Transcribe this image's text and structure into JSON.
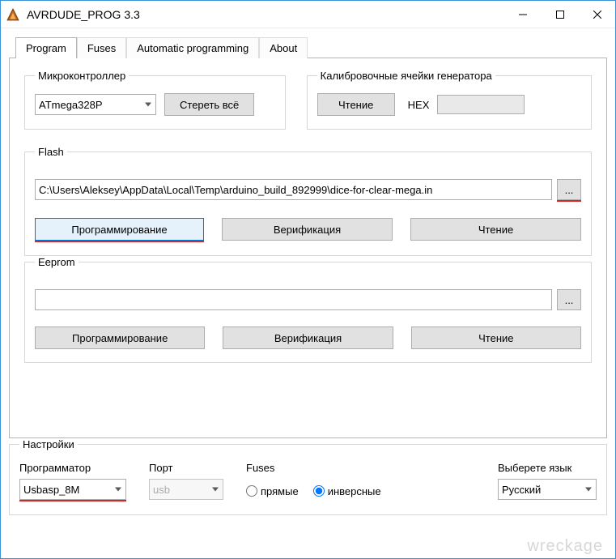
{
  "window": {
    "title": "AVRDUDE_PROG 3.3"
  },
  "tabs": {
    "program": "Program",
    "fuses": "Fuses",
    "auto": "Automatic programming",
    "about": "About"
  },
  "mcu": {
    "legend": "Микроконтроллер",
    "selected": "ATmega328P",
    "erase": "Стереть всё"
  },
  "calib": {
    "legend": "Калибровочные ячейки генератора",
    "read": "Чтение",
    "hex_label": "HEX"
  },
  "flash": {
    "legend": "Flash",
    "path": "C:\\Users\\Aleksey\\AppData\\Local\\Temp\\arduino_build_892999\\dice-for-clear-mega.in",
    "browse": "...",
    "program": "Программирование",
    "verify": "Верификация",
    "read": "Чтение"
  },
  "eeprom": {
    "legend": "Eeprom",
    "path": "",
    "browse": "...",
    "program": "Программирование",
    "verify": "Верификация",
    "read": "Чтение"
  },
  "settings": {
    "legend": "Настройки",
    "programmer_label": "Программатор",
    "programmer_value": "Usbasp_8M",
    "port_label": "Порт",
    "port_value": "usb",
    "fuses_label": "Fuses",
    "fuses_direct": "прямые",
    "fuses_inverse": "инверсные",
    "fuses_selected": "inverse",
    "lang_label": "Выберете язык",
    "lang_value": "Русский"
  }
}
